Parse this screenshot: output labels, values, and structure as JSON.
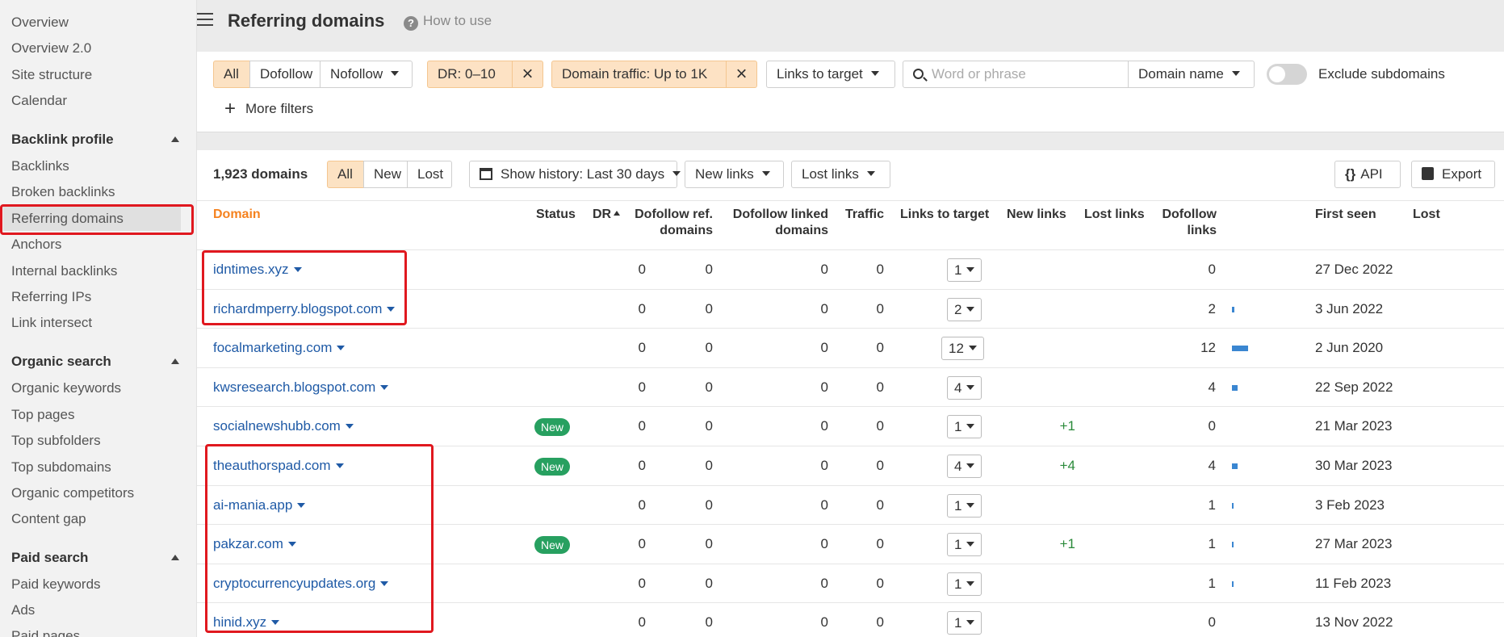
{
  "sidebar": {
    "top_items": [
      "Overview",
      "Overview 2.0",
      "Site structure",
      "Calendar"
    ],
    "sections": [
      {
        "title": "Backlink profile",
        "items": [
          "Backlinks",
          "Broken backlinks",
          "Referring domains",
          "Anchors",
          "Internal backlinks",
          "Referring IPs",
          "Link intersect"
        ]
      },
      {
        "title": "Organic search",
        "items": [
          "Organic keywords",
          "Top pages",
          "Top subfolders",
          "Top subdomains",
          "Organic competitors",
          "Content gap"
        ]
      },
      {
        "title": "Paid search",
        "items": [
          "Paid keywords",
          "Ads",
          "Paid pages"
        ]
      }
    ],
    "active_item": "Referring domains"
  },
  "header": {
    "title": "Referring domains",
    "how_to_use": "How to use"
  },
  "filters": {
    "link_type": {
      "all": "All",
      "dofollow": "Dofollow",
      "nofollow": "Nofollow"
    },
    "dr_chip": "DR: 0–10",
    "traffic_chip": "Domain traffic: Up to 1K",
    "links_to_target": "Links to target",
    "search_placeholder": "Word or phrase",
    "search_scope": "Domain name",
    "exclude_subdomains": "Exclude subdomains",
    "more_filters": "More filters"
  },
  "toolbar": {
    "count": "1,923 domains",
    "tabs": {
      "all": "All",
      "new": "New",
      "lost": "Lost"
    },
    "history": "Show history: Last 30 days",
    "new_links": "New links",
    "lost_links": "Lost links",
    "api": "API",
    "export": "Export"
  },
  "table": {
    "headers": {
      "domain": "Domain",
      "status": "Status",
      "dr": "DR",
      "dofollow_ref_1": "Dofollow ref.",
      "dofollow_ref_2": "domains",
      "dofollow_linked_1": "Dofollow linked",
      "dofollow_linked_2": "domains",
      "traffic": "Traffic",
      "links_to_target": "Links to target",
      "new_links": "New links",
      "lost_links": "Lost links",
      "dofollow_links_1": "Dofollow",
      "dofollow_links_2": "links",
      "first_seen": "First seen",
      "lost": "Lost"
    },
    "rows": [
      {
        "domain": "idntimes.xyz",
        "status": "",
        "dr": "0",
        "ref": "0",
        "linked": "0",
        "traffic": "0",
        "ltt": "1",
        "new": "",
        "lost": "",
        "dofollow": "0",
        "bar": 0,
        "first_seen": "27 Dec 2022"
      },
      {
        "domain": "richardmperry.blogspot.com",
        "status": "",
        "dr": "0",
        "ref": "0",
        "linked": "0",
        "traffic": "0",
        "ltt": "2",
        "new": "",
        "lost": "",
        "dofollow": "2",
        "bar": 2,
        "first_seen": "3 Jun 2022"
      },
      {
        "domain": "focalmarketing.com",
        "status": "",
        "dr": "0",
        "ref": "0",
        "linked": "0",
        "traffic": "0",
        "ltt": "12",
        "new": "",
        "lost": "",
        "dofollow": "12",
        "bar": 12,
        "first_seen": "2 Jun 2020"
      },
      {
        "domain": "kwsresearch.blogspot.com",
        "status": "",
        "dr": "0",
        "ref": "0",
        "linked": "0",
        "traffic": "0",
        "ltt": "4",
        "new": "",
        "lost": "",
        "dofollow": "4",
        "bar": 4,
        "first_seen": "22 Sep 2022"
      },
      {
        "domain": "socialnewshubb.com",
        "status": "New",
        "dr": "0",
        "ref": "0",
        "linked": "0",
        "traffic": "0",
        "ltt": "1",
        "new": "+1",
        "lost": "",
        "dofollow": "0",
        "bar": 0,
        "first_seen": "21 Mar 2023"
      },
      {
        "domain": "theauthorspad.com",
        "status": "New",
        "dr": "0",
        "ref": "0",
        "linked": "0",
        "traffic": "0",
        "ltt": "4",
        "new": "+4",
        "lost": "",
        "dofollow": "4",
        "bar": 4,
        "first_seen": "30 Mar 2023"
      },
      {
        "domain": "ai-mania.app",
        "status": "",
        "dr": "0",
        "ref": "0",
        "linked": "0",
        "traffic": "0",
        "ltt": "1",
        "new": "",
        "lost": "",
        "dofollow": "1",
        "bar": 1,
        "first_seen": "3 Feb 2023"
      },
      {
        "domain": "pakzar.com",
        "status": "New",
        "dr": "0",
        "ref": "0",
        "linked": "0",
        "traffic": "0",
        "ltt": "1",
        "new": "+1",
        "lost": "",
        "dofollow": "1",
        "bar": 1,
        "first_seen": "27 Mar 2023"
      },
      {
        "domain": "cryptocurrencyupdates.org",
        "status": "",
        "dr": "0",
        "ref": "0",
        "linked": "0",
        "traffic": "0",
        "ltt": "1",
        "new": "",
        "lost": "",
        "dofollow": "1",
        "bar": 1,
        "first_seen": "11 Feb 2023"
      },
      {
        "domain": "hinid.xyz",
        "status": "",
        "dr": "0",
        "ref": "0",
        "linked": "0",
        "traffic": "0",
        "ltt": "1",
        "new": "",
        "lost": "",
        "dofollow": "0",
        "bar": 0,
        "first_seen": "13 Nov 2022"
      }
    ]
  },
  "colors": {
    "accent_orange": "#f5821f",
    "link_blue": "#1f5aa6",
    "badge_green": "#27a060",
    "highlight_red": "#e0181f",
    "chip_bg": "#fde2c4",
    "bar_blue": "#3a86d1"
  }
}
